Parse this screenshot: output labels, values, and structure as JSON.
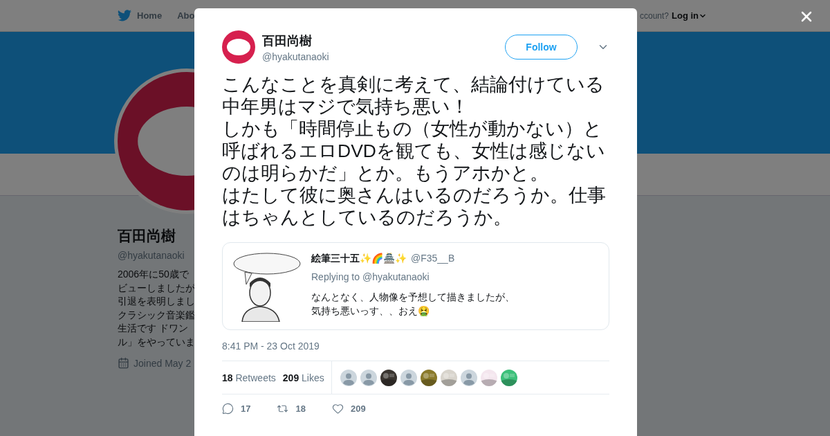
{
  "page": {
    "nav": {
      "home": "Home",
      "about": "Abo",
      "account": "ccount?",
      "login": "Log in"
    },
    "profile": {
      "name": "百田尚樹",
      "handle": "@hyakutanaoki",
      "bio": [
        "2006年に50歳で",
        "ビューしましたが",
        "引退を表明しまし",
        "クラシック音楽鑑",
        "生活です ドワン",
        "ル」をやっていま"
      ],
      "joined": "Joined May 2"
    }
  },
  "tweet": {
    "author": {
      "name": "百田尚樹",
      "handle": "@hyakutanaoki"
    },
    "follow": "Follow",
    "text": [
      "こんなことを真剣に考えて、結論付けている中年男はマジで気持ち悪い！",
      "しかも「時間停止もの（女性が動かない）と呼ばれるエロDVDを観ても、女性は感じないのは明らかだ」とか。もうアホかと。",
      "はたして彼に奥さんはいるのだろうか。仕事はちゃんとしているのだろうか。"
    ],
    "quote": {
      "name": "絵筆三十五✨🌈🏯✨",
      "handle": "@F35__B",
      "reply": "Replying to @hyakutanaoki",
      "text": [
        "なんとなく、人物像を予想して描きましたが、",
        "気持ち悪いっす、、おえ🤮"
      ]
    },
    "time": "8:41 PM - 23 Oct 2019",
    "stats": [
      {
        "count": "18",
        "label": "Retweets"
      },
      {
        "count": "209",
        "label": "Likes"
      }
    ],
    "likers": [
      {
        "kind": "default"
      },
      {
        "kind": "default"
      },
      {
        "kind": "picture",
        "color": "#3a3530"
      },
      {
        "kind": "default"
      },
      {
        "kind": "picture",
        "color": "#8a7a2a"
      },
      {
        "kind": "picture",
        "color": "#d8d4cc"
      },
      {
        "kind": "default"
      },
      {
        "kind": "picture",
        "color": "#f4e6ee"
      },
      {
        "kind": "picture",
        "color": "#3cc07a"
      }
    ],
    "actions": [
      {
        "kind": "reply",
        "count": "17"
      },
      {
        "kind": "retweet",
        "count": "18"
      },
      {
        "kind": "like",
        "count": "209"
      }
    ]
  }
}
